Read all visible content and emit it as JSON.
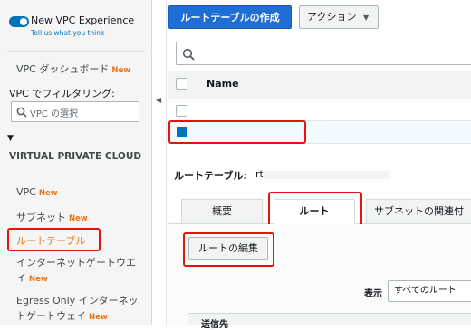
{
  "sidebar": {
    "new_experience": {
      "title": "New VPC Experience",
      "subtitle": "Tell us what you think",
      "toggle_on": true
    },
    "dashboard": {
      "label": "VPC ダッシュボード",
      "badge": "New"
    },
    "filter": {
      "label": "VPC でフィルタリング:",
      "placeholder": "VPC の選択"
    },
    "section_title": "VIRTUAL PRIVATE CLOUD",
    "items": [
      {
        "label": "VPC",
        "badge": "New"
      },
      {
        "label": "サブネット",
        "badge": "New"
      },
      {
        "label": "ルートテーブル",
        "badge": ""
      },
      {
        "label": "インターネットゲートウエイ",
        "badge": "New"
      },
      {
        "label": "Egress Only インターネットゲートウェイ",
        "badge": "New"
      }
    ]
  },
  "toolbar": {
    "create_label": "ルートテーブルの作成",
    "actions_label": "アクション"
  },
  "table": {
    "header_name": "Name"
  },
  "detail": {
    "route_table_label": "ルートテーブル:",
    "route_table_value": "rt"
  },
  "tabs": [
    {
      "label": "概要"
    },
    {
      "label": "ルート"
    },
    {
      "label": "サブネットの関連付"
    }
  ],
  "routes": {
    "edit_label": "ルートの編集",
    "show_label": "表示",
    "show_value": "すべてのルート",
    "destination_header": "送信先"
  },
  "colors": {
    "primary": "#1f6ed4",
    "accent_orange": "#ec7211",
    "highlight_red": "#e8140a",
    "selected_check": "#0073bb"
  }
}
